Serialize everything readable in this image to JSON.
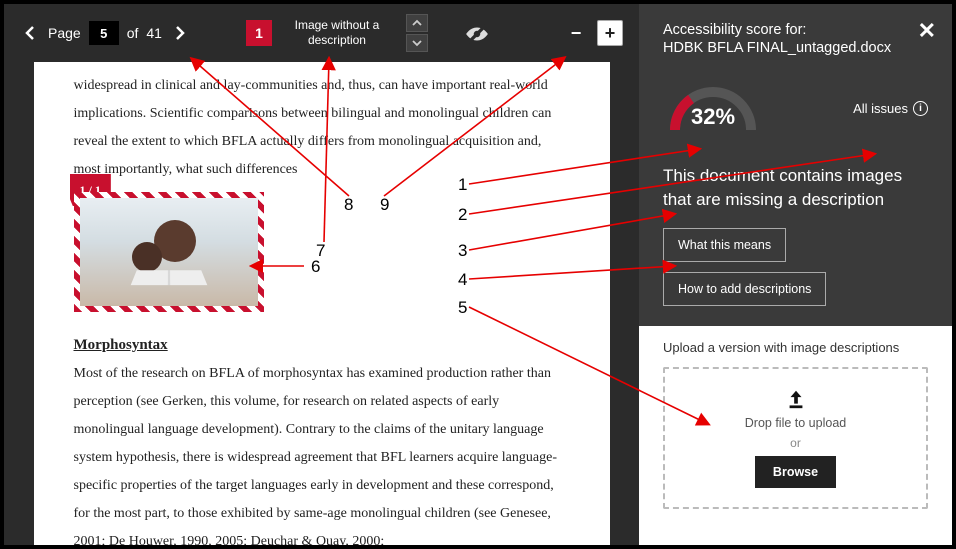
{
  "toolbar": {
    "page_label": "Page",
    "page_current": "5",
    "page_of": "of",
    "page_total": "41",
    "issue_count": "1",
    "issue_text_line1": "Image without a",
    "issue_text_line2": "description"
  },
  "doc": {
    "para_top": "widespread in clinical and lay-communities and, thus, can have important real-world implications. Scientific comparisons between bilingual and monolingual children can reveal the extent to which BFLA actually differs from monolingual acquisition and, most importantly, what such differences",
    "image_counter": "1 / 1",
    "heading": "Morphosyntax",
    "para_bottom": "Most of the research on BFLA of morphosyntax has examined production rather than perception (see Gerken, this volume, for research on related aspects of early monolingual language development). Contrary to the claims of the unitary language system hypothesis, there is widespread agreement that BFL learners acquire language-specific properties of the target languages early in development and these correspond, for the most part, to those exhibited by same-age monolingual children (see Genesee,  2001; De Houwer, 1990, 2005; Deuchar & Quay, 2000;"
  },
  "panel": {
    "score_for": "Accessibility score for:",
    "file_name": "HDBK BFLA FINAL_untagged.docx",
    "score_value": "32%",
    "all_issues": "All issues",
    "issue_desc": "This document contains images that are missing a description",
    "what_means": "What this means",
    "how_add": "How to add descriptions",
    "upload_hint": "Upload a version with image descriptions",
    "drop_text": "Drop file to upload",
    "or": "or",
    "browse": "Browse"
  },
  "annotations": {
    "n1": "1",
    "n2": "2",
    "n3": "3",
    "n4": "4",
    "n5": "5",
    "n6": "6",
    "n7": "7",
    "n8": "8",
    "n9": "9"
  }
}
